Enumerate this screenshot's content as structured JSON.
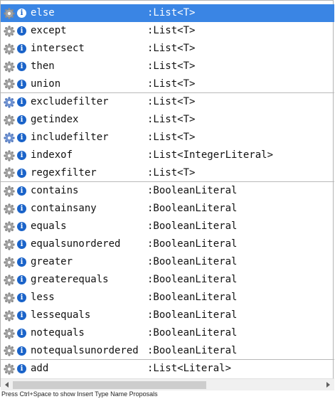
{
  "proposals": [
    {
      "name": "else",
      "type": ":List<T>",
      "icon": "gear-icon",
      "selected": true
    },
    {
      "name": "except",
      "type": ":List<T>",
      "icon": "gear-icon"
    },
    {
      "name": "intersect",
      "type": ":List<T>",
      "icon": "gear-icon"
    },
    {
      "name": "then",
      "type": ":List<T>",
      "icon": "gear-icon"
    },
    {
      "name": "union",
      "type": ":List<T>",
      "icon": "gear-icon",
      "separator_after": true
    },
    {
      "name": "excludefilter",
      "type": ":List<T>",
      "icon": "filter-gear-icon"
    },
    {
      "name": "getindex",
      "type": ":List<T>",
      "icon": "gear-icon"
    },
    {
      "name": "includefilter",
      "type": ":List<T>",
      "icon": "filter-gear-icon"
    },
    {
      "name": "indexof",
      "type": ":List<IntegerLiteral>",
      "icon": "gear-icon"
    },
    {
      "name": "regexfilter",
      "type": ":List<T>",
      "icon": "gear-icon",
      "separator_after": true
    },
    {
      "name": "contains",
      "type": ":BooleanLiteral",
      "icon": "gear-icon"
    },
    {
      "name": "containsany",
      "type": ":BooleanLiteral",
      "icon": "gear-icon"
    },
    {
      "name": "equals",
      "type": ":BooleanLiteral",
      "icon": "gear-icon"
    },
    {
      "name": "equalsunordered",
      "type": ":BooleanLiteral",
      "icon": "gear-icon"
    },
    {
      "name": "greater",
      "type": ":BooleanLiteral",
      "icon": "gear-icon"
    },
    {
      "name": "greaterequals",
      "type": ":BooleanLiteral",
      "icon": "gear-icon"
    },
    {
      "name": "less",
      "type": ":BooleanLiteral",
      "icon": "gear-icon"
    },
    {
      "name": "lessequals",
      "type": ":BooleanLiteral",
      "icon": "gear-icon"
    },
    {
      "name": "notequals",
      "type": ":BooleanLiteral",
      "icon": "gear-icon"
    },
    {
      "name": "notequalsunordered",
      "type": ":BooleanLiteral",
      "icon": "gear-icon",
      "separator_after": true
    },
    {
      "name": "add",
      "type": ":List<Literal>",
      "icon": "gear-icon"
    }
  ],
  "info_glyph": "i",
  "status_text": "Press Ctrl+Space to show Insert Type Name Proposals",
  "colors": {
    "selection": "#3a85e4",
    "info": "#1a63c9",
    "separator": "#b9b9b9"
  }
}
